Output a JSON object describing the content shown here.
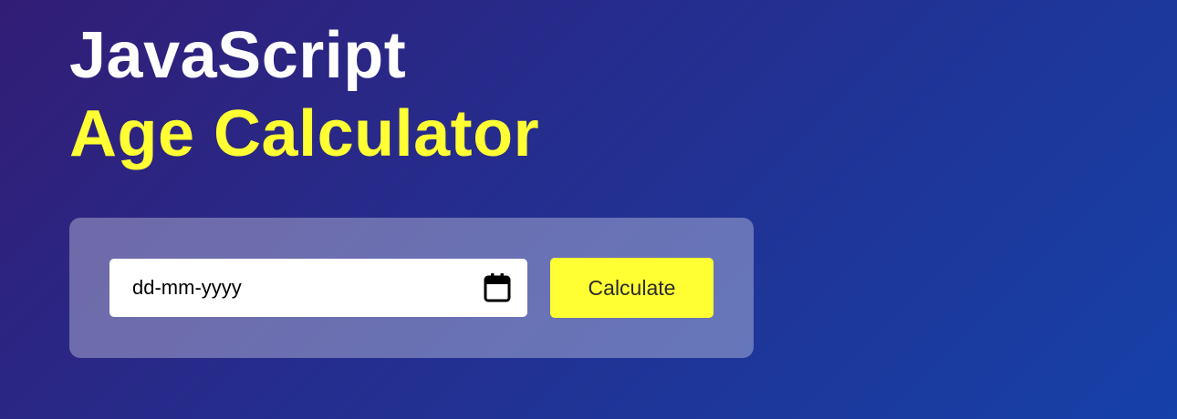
{
  "header": {
    "title_line_1": "JavaScript",
    "title_line_2": "Age Calculator"
  },
  "form": {
    "date_input": {
      "placeholder": "dd-mm-yyyy",
      "icon": "calendar-icon"
    },
    "calculate_label": "Calculate"
  },
  "colors": {
    "accent": "#ffff33",
    "title_primary": "#ffffff",
    "background_start": "#321d76",
    "background_end": "#1641a8"
  }
}
